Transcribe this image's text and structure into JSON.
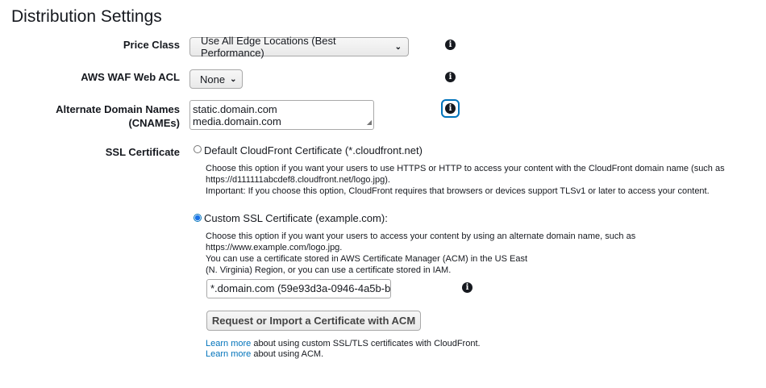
{
  "page": {
    "title": "Distribution Settings"
  },
  "price_class": {
    "label": "Price Class",
    "selected": "Use All Edge Locations (Best Performance)"
  },
  "waf": {
    "label": "AWS WAF Web ACL",
    "selected": "None"
  },
  "cnames": {
    "label_line1": "Alternate Domain Names",
    "label_line2": "(CNAMEs)",
    "values": [
      "static.domain.com",
      "media.domain.com"
    ]
  },
  "ssl": {
    "label": "SSL Certificate",
    "default_option": {
      "label": "Default CloudFront Certificate (*.cloudfront.net)",
      "checked": false,
      "desc_line1": "Choose this option if you want your users to use HTTPS or HTTP to access your content with the CloudFront domain name (such as",
      "desc_line2": "https://d111111abcdef8.cloudfront.net/logo.jpg).",
      "desc_line3": "Important: If you choose this option, CloudFront requires that browsers or devices support TLSv1 or later to access your content."
    },
    "custom_option": {
      "label": "Custom SSL Certificate (example.com):",
      "checked": true,
      "desc_line1": "Choose this option if you want your users to access your content by using an alternate domain name, such as https://www.example.com/logo.jpg.",
      "desc_line2": "You can use a certificate stored in AWS Certificate Manager (ACM) in the US East",
      "desc_line3": "(N. Virginia) Region, or you can use a certificate stored in IAM."
    },
    "certificate_value": "*.domain.com (59e93d3a-0946-4a5b-b",
    "request_button": "Request or Import a Certificate with ACM",
    "learn1_link": "Learn more",
    "learn1_text": " about using custom SSL/TLS certificates with CloudFront.",
    "learn2_link": "Learn more",
    "learn2_text": " about using ACM."
  },
  "icons": {
    "info": "info-icon",
    "chevron": "chevron-down-icon",
    "resize": "resize-handle-icon"
  }
}
